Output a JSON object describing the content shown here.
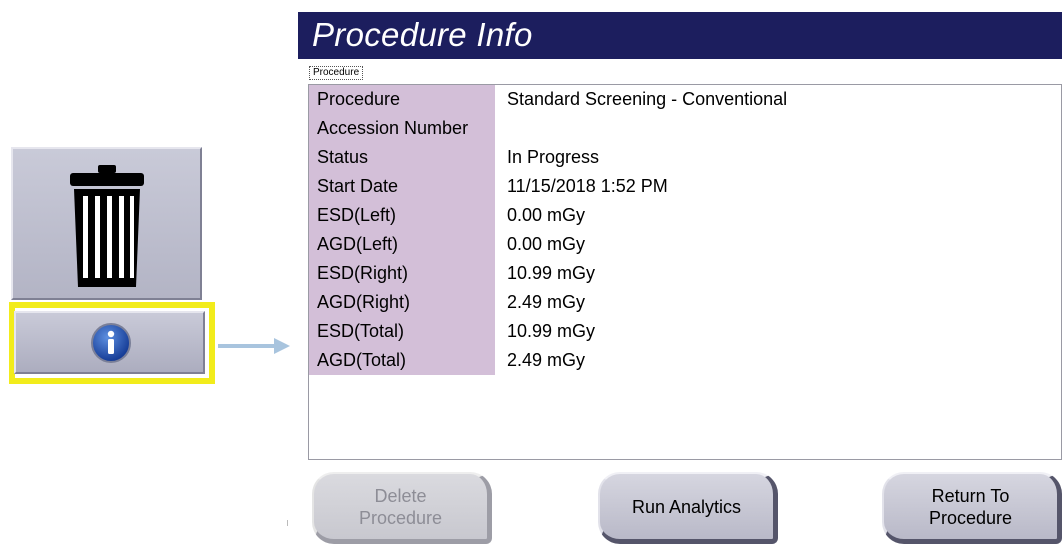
{
  "dialog": {
    "title": "Procedure Info",
    "tab_label": "Procedure"
  },
  "toolbar": {
    "trash_icon": "trash-icon",
    "info_icon": "info-icon",
    "highlight_color": "#f2ec1b"
  },
  "procedure_info": {
    "rows": [
      {
        "label": "Procedure",
        "value": "Standard Screening - Conventional"
      },
      {
        "label": "Accession Number",
        "value": ""
      },
      {
        "label": "Status",
        "value": "In Progress"
      },
      {
        "label": "Start Date",
        "value": "11/15/2018 1:52 PM"
      },
      {
        "label": "ESD(Left)",
        "value": "0.00 mGy"
      },
      {
        "label": "AGD(Left)",
        "value": "0.00 mGy"
      },
      {
        "label": "ESD(Right)",
        "value": "10.99 mGy"
      },
      {
        "label": "AGD(Right)",
        "value": "2.49 mGy"
      },
      {
        "label": "ESD(Total)",
        "value": "10.99 mGy"
      },
      {
        "label": "AGD(Total)",
        "value": "2.49 mGy"
      }
    ]
  },
  "buttons": {
    "delete": {
      "line1": "Delete",
      "line2": "Procedure",
      "enabled": false
    },
    "analytics": {
      "label": "Run Analytics",
      "enabled": true
    },
    "return": {
      "line1": "Return To",
      "line2": "Procedure",
      "enabled": true
    }
  },
  "colors": {
    "title_bar": "#1c1e5e",
    "label_column": "#d3bfd8",
    "button_face": "#c9cad8"
  }
}
